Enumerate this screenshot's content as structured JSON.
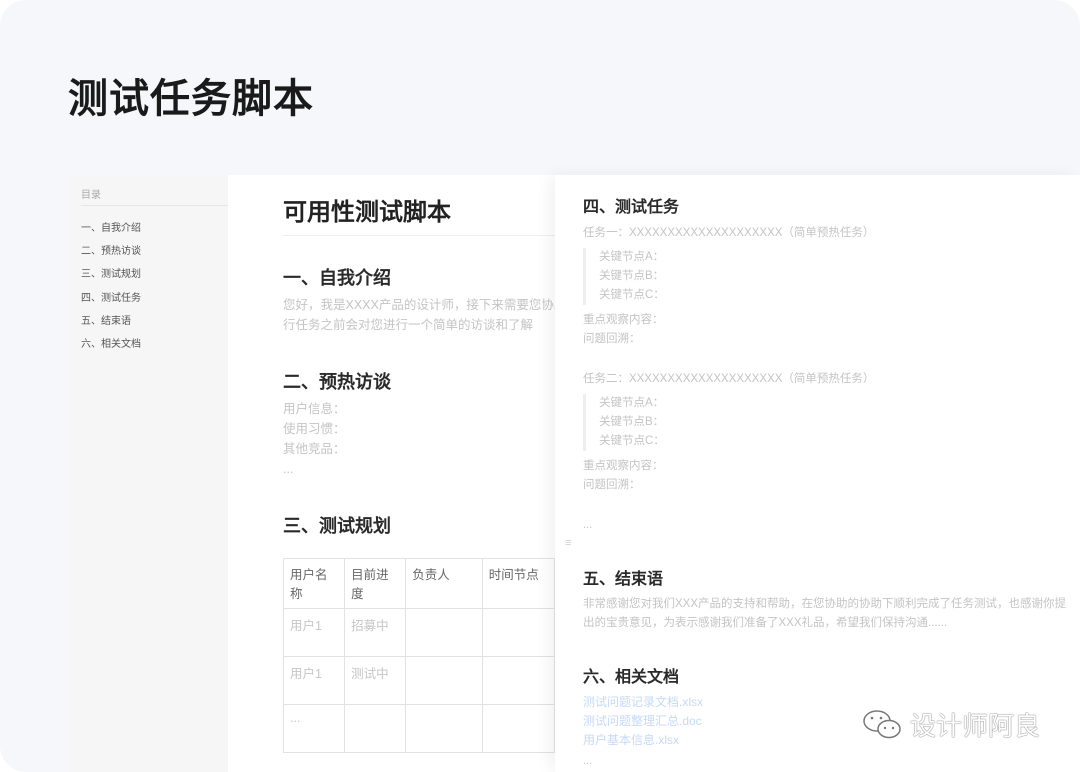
{
  "page_title": "测试任务脚本",
  "sidebar": {
    "heading": "目录",
    "items": [
      "一、自我介绍",
      "二、预热访谈",
      "三、测试规划",
      "四、测试任务",
      "五、结束语",
      "六、相关文档"
    ]
  },
  "doc": {
    "title": "可用性测试脚本",
    "s1": {
      "heading": "一、自我介绍",
      "lines": [
        "您好，我是XXXX产品的设计师，接下来需要您协助",
        "行任务之前会对您进行一个简单的访谈和了解"
      ]
    },
    "s2": {
      "heading": "二、预热访谈",
      "lines": [
        "用户信息：",
        "使用习惯：",
        "其他竞品：",
        "..."
      ]
    },
    "s3": {
      "heading": "三、测试规划",
      "columns": [
        "用户名称",
        "目前进度",
        "负责人",
        "时间节点"
      ],
      "rows": [
        [
          "用户1",
          "招募中",
          "",
          ""
        ],
        [
          "用户1",
          "测试中",
          "",
          ""
        ],
        [
          "...",
          "",
          "",
          ""
        ]
      ]
    }
  },
  "right": {
    "s4": {
      "heading": "四、测试任务",
      "tasks": [
        {
          "title": "任务一：XXXXXXXXXXXXXXXXXXXX（简单预热任务）",
          "nodes": [
            "关键节点A：",
            "关键节点B：",
            "关键节点C："
          ],
          "observe": "重点观察内容：",
          "review": "问题回溯："
        },
        {
          "title": "任务二：XXXXXXXXXXXXXXXXXXXX（简单预热任务）",
          "nodes": [
            "关键节点A：",
            "关键节点B：",
            "关键节点C："
          ],
          "observe": "重点观察内容：",
          "review": "问题回溯："
        }
      ],
      "ellipsis": "..."
    },
    "s5": {
      "heading": "五、结束语",
      "lines": [
        "非常感谢您对我们XXX产品的支持和帮助，在您协助的协助下顺利完成了任务测试，也感谢你提",
        "出的宝贵意见，为表示感谢我们准备了XXX礼品，希望我们保持沟通......"
      ]
    },
    "s6": {
      "heading": "六、相关文档",
      "links": [
        "测试问题记录文档.xlsx",
        "测试问题整理汇总.doc",
        "用户基本信息.xlsx"
      ],
      "ellipsis": "..."
    }
  },
  "watermark": "设计师阿良"
}
